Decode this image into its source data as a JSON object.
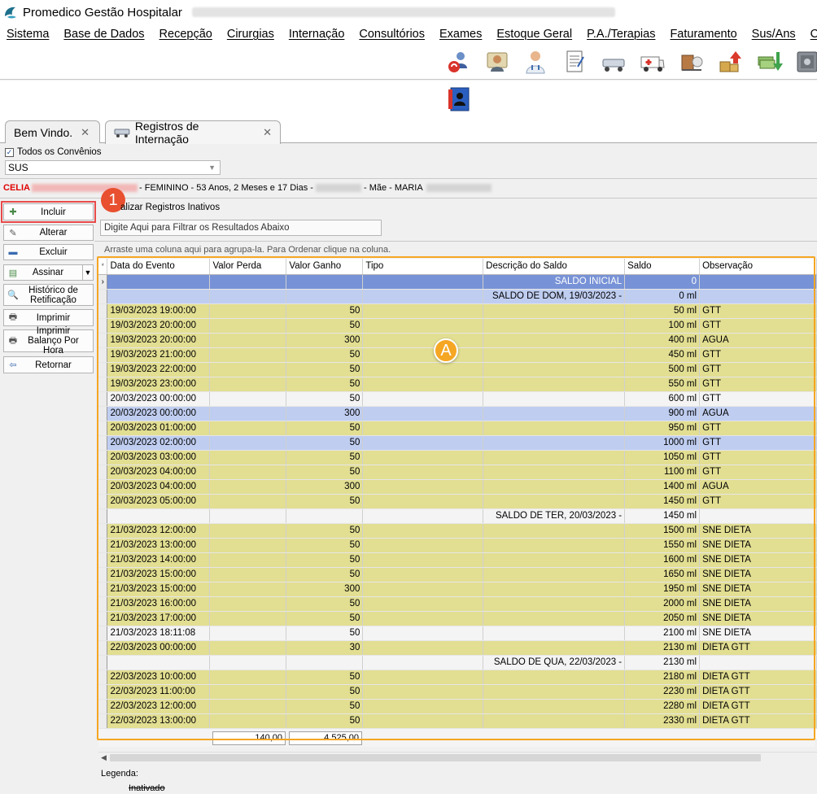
{
  "window": {
    "title": "Promedico Gestão Hospitalar"
  },
  "menu": [
    "Sistema",
    "Base de Dados",
    "Recepção",
    "Cirurgias",
    "Internação",
    "Consultórios",
    "Exames",
    "Estoque Geral",
    "P.A./Terapias",
    "Faturamento",
    "Sus/Ans",
    "C"
  ],
  "toolbar_icons": [
    "users-sync-icon",
    "reception-icon",
    "doctor-icon",
    "document-icon",
    "ambulance-bed-icon",
    "ambulance-icon",
    "pharmacy-icon",
    "boxes-up-icon",
    "money-down-icon",
    "safe-icon",
    "agenda-book-icon"
  ],
  "tabs": [
    {
      "label": "Bem Vindo.",
      "close": "✕"
    },
    {
      "label": "Registros de Internação",
      "close": "✕"
    }
  ],
  "filters": {
    "todos_convenios_label": "Todos os Convênios",
    "todos_convenios_checked": "✓",
    "convenio_value": "SUS"
  },
  "patient": {
    "name": "CELIA",
    "info_a": "- FEMININO - 53 Anos, 2 Meses e 17 Dias -",
    "info_b": "- Mãe - MARIA"
  },
  "sidebar": {
    "incluir": "Incluir",
    "alterar": "Alterar",
    "excluir": "Excluir",
    "assinar": "Assinar",
    "historico": "Histórico de Retificação",
    "imprimir": "Imprimir",
    "imprimir_balanco": "Imprimir Balanço Por Hora",
    "retornar": "Retornar"
  },
  "inativos_label": "alizar Registros Inativos",
  "filter_placeholder": "Digite Aqui para Filtrar os Resultados Abaixo",
  "group_hint": "Arraste uma coluna aqui para agrupa-la. Para Ordenar clique na coluna.",
  "markers": {
    "one": "1",
    "a": "A"
  },
  "grid": {
    "header_indicator": "*",
    "columns": [
      "Data do Evento",
      "Valor Perda",
      "Valor Ganho",
      "Tipo",
      "Descrição do Saldo",
      "Saldo",
      "Observação"
    ],
    "rows": [
      {
        "style": "sel",
        "ind": "›",
        "data": "",
        "perda": "",
        "ganho": "",
        "tipo": "",
        "descricao": "SALDO INICIAL",
        "saldo": "0",
        "obs": ""
      },
      {
        "style": "blue",
        "ind": "",
        "data": "",
        "perda": "",
        "ganho": "",
        "tipo": "",
        "descricao": "SALDO DE DOM, 19/03/2023 -",
        "saldo": "0 ml",
        "obs": ""
      },
      {
        "style": "yellow",
        "ind": "",
        "data": "19/03/2023 19:00:00",
        "perda": "",
        "ganho": "50",
        "tipo": "",
        "descricao": "",
        "saldo": "50 ml",
        "obs": "GTT"
      },
      {
        "style": "yellow",
        "ind": "",
        "data": "19/03/2023 20:00:00",
        "perda": "",
        "ganho": "50",
        "tipo": "",
        "descricao": "",
        "saldo": "100 ml",
        "obs": "GTT"
      },
      {
        "style": "yellow",
        "ind": "",
        "data": "19/03/2023 20:00:00",
        "perda": "",
        "ganho": "300",
        "tipo": "",
        "descricao": "",
        "saldo": "400 ml",
        "obs": "AGUA"
      },
      {
        "style": "yellow",
        "ind": "",
        "data": "19/03/2023 21:00:00",
        "perda": "",
        "ganho": "50",
        "tipo": "",
        "descricao": "",
        "saldo": "450 ml",
        "obs": "GTT"
      },
      {
        "style": "yellow",
        "ind": "",
        "data": "19/03/2023 22:00:00",
        "perda": "",
        "ganho": "50",
        "tipo": "",
        "descricao": "",
        "saldo": "500 ml",
        "obs": "GTT"
      },
      {
        "style": "yellow",
        "ind": "",
        "data": "19/03/2023 23:00:00",
        "perda": "",
        "ganho": "50",
        "tipo": "",
        "descricao": "",
        "saldo": "550 ml",
        "obs": "GTT"
      },
      {
        "style": "white",
        "ind": "",
        "data": "20/03/2023 00:00:00",
        "perda": "",
        "ganho": "50",
        "tipo": "",
        "descricao": "",
        "saldo": "600 ml",
        "obs": "GTT"
      },
      {
        "style": "blue",
        "ind": "",
        "data": "20/03/2023 00:00:00",
        "perda": "",
        "ganho": "300",
        "tipo": "",
        "descricao": "",
        "saldo": "900 ml",
        "obs": "AGUA"
      },
      {
        "style": "yellow",
        "ind": "",
        "data": "20/03/2023 01:00:00",
        "perda": "",
        "ganho": "50",
        "tipo": "",
        "descricao": "",
        "saldo": "950 ml",
        "obs": "GTT"
      },
      {
        "style": "blue",
        "ind": "",
        "data": "20/03/2023 02:00:00",
        "perda": "",
        "ganho": "50",
        "tipo": "",
        "descricao": "",
        "saldo": "1000 ml",
        "obs": "GTT"
      },
      {
        "style": "yellow",
        "ind": "",
        "data": "20/03/2023 03:00:00",
        "perda": "",
        "ganho": "50",
        "tipo": "",
        "descricao": "",
        "saldo": "1050 ml",
        "obs": "GTT"
      },
      {
        "style": "yellow",
        "ind": "",
        "data": "20/03/2023 04:00:00",
        "perda": "",
        "ganho": "50",
        "tipo": "",
        "descricao": "",
        "saldo": "1100 ml",
        "obs": "GTT"
      },
      {
        "style": "yellow",
        "ind": "",
        "data": "20/03/2023 04:00:00",
        "perda": "",
        "ganho": "300",
        "tipo": "",
        "descricao": "",
        "saldo": "1400 ml",
        "obs": "AGUA"
      },
      {
        "style": "yellow",
        "ind": "",
        "data": "20/03/2023 05:00:00",
        "perda": "",
        "ganho": "50",
        "tipo": "",
        "descricao": "",
        "saldo": "1450 ml",
        "obs": "GTT"
      },
      {
        "style": "white",
        "ind": "",
        "data": "",
        "perda": "",
        "ganho": "",
        "tipo": "",
        "descricao": "SALDO DE TER, 20/03/2023 -",
        "saldo": "1450 ml",
        "obs": ""
      },
      {
        "style": "yellow",
        "ind": "",
        "data": "21/03/2023 12:00:00",
        "perda": "",
        "ganho": "50",
        "tipo": "",
        "descricao": "",
        "saldo": "1500 ml",
        "obs": "SNE DIETA"
      },
      {
        "style": "yellow",
        "ind": "",
        "data": "21/03/2023 13:00:00",
        "perda": "",
        "ganho": "50",
        "tipo": "",
        "descricao": "",
        "saldo": "1550 ml",
        "obs": "SNE DIETA"
      },
      {
        "style": "yellow",
        "ind": "",
        "data": "21/03/2023 14:00:00",
        "perda": "",
        "ganho": "50",
        "tipo": "",
        "descricao": "",
        "saldo": "1600 ml",
        "obs": "SNE DIETA"
      },
      {
        "style": "yellow",
        "ind": "",
        "data": "21/03/2023 15:00:00",
        "perda": "",
        "ganho": "50",
        "tipo": "",
        "descricao": "",
        "saldo": "1650 ml",
        "obs": "SNE DIETA"
      },
      {
        "style": "yellow",
        "ind": "",
        "data": "21/03/2023 15:00:00",
        "perda": "",
        "ganho": "300",
        "tipo": "",
        "descricao": "",
        "saldo": "1950 ml",
        "obs": "SNE DIETA"
      },
      {
        "style": "yellow",
        "ind": "",
        "data": "21/03/2023 16:00:00",
        "perda": "",
        "ganho": "50",
        "tipo": "",
        "descricao": "",
        "saldo": "2000 ml",
        "obs": "SNE DIETA"
      },
      {
        "style": "yellow",
        "ind": "",
        "data": "21/03/2023 17:00:00",
        "perda": "",
        "ganho": "50",
        "tipo": "",
        "descricao": "",
        "saldo": "2050 ml",
        "obs": "SNE DIETA"
      },
      {
        "style": "white",
        "ind": "",
        "data": "21/03/2023 18:11:08",
        "perda": "",
        "ganho": "50",
        "tipo": "",
        "descricao": "",
        "saldo": "2100 ml",
        "obs": "SNE DIETA"
      },
      {
        "style": "yellow",
        "ind": "",
        "data": "22/03/2023 00:00:00",
        "perda": "",
        "ganho": "30",
        "tipo": "",
        "descricao": "",
        "saldo": "2130 ml",
        "obs": "DIETA GTT"
      },
      {
        "style": "white",
        "ind": "",
        "data": "",
        "perda": "",
        "ganho": "",
        "tipo": "",
        "descricao": "SALDO DE QUA, 22/03/2023 -",
        "saldo": "2130 ml",
        "obs": ""
      },
      {
        "style": "yellow",
        "ind": "",
        "data": "22/03/2023 10:00:00",
        "perda": "",
        "ganho": "50",
        "tipo": "",
        "descricao": "",
        "saldo": "2180 ml",
        "obs": "DIETA GTT"
      },
      {
        "style": "yellow",
        "ind": "",
        "data": "22/03/2023 11:00:00",
        "perda": "",
        "ganho": "50",
        "tipo": "",
        "descricao": "",
        "saldo": "2230 ml",
        "obs": "DIETA GTT"
      },
      {
        "style": "yellow",
        "ind": "",
        "data": "22/03/2023 12:00:00",
        "perda": "",
        "ganho": "50",
        "tipo": "",
        "descricao": "",
        "saldo": "2280 ml",
        "obs": "DIETA GTT"
      },
      {
        "style": "yellow",
        "ind": "",
        "data": "22/03/2023 13:00:00",
        "perda": "",
        "ganho": "50",
        "tipo": "",
        "descricao": "",
        "saldo": "2330 ml",
        "obs": "DIETA GTT"
      }
    ],
    "totals": {
      "perda": "140,00",
      "ganho": "4.525,00"
    }
  },
  "legend": {
    "title": "Legenda:",
    "inativado": "Inativado"
  },
  "colors": {
    "highlight_frame": "#f5a623",
    "marker_red": "#e8502f",
    "row_yellow": "#e2de92",
    "row_blue": "#bfcdf0",
    "row_selected": "#7792d6",
    "patient_name": "#e00000"
  }
}
